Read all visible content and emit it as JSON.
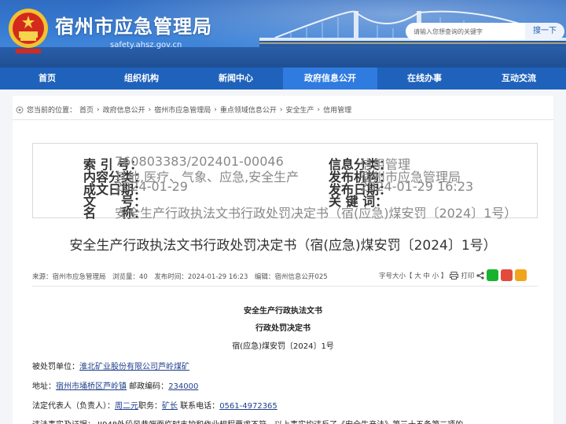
{
  "header": {
    "site_title": "宿州市应急管理局",
    "site_domain": "safety.ahsz.gov.cn",
    "search_placeholder": "请输入您想查询的关键字",
    "search_button": "搜一下"
  },
  "nav": {
    "items": [
      "首页",
      "组织机构",
      "新闻中心",
      "政府信息公开",
      "在线办事",
      "互动交流"
    ],
    "active_index": 3
  },
  "breadcrumb": {
    "prefix": "您当前的位置：",
    "items": [
      "首页",
      "政府信息公开",
      "宿州市应急管理局",
      "重点领域信息公开",
      "安全生产",
      "信用管理"
    ],
    "separator": "›"
  },
  "meta": {
    "index_label": "索 引 号：",
    "index_value": "760803383/202401-00046",
    "content_class_label": "内容分类：",
    "content_class_value": "其他,医疗、气象、应急,安全生产",
    "created_label": "成文日期：",
    "created_value": "2024-01-29",
    "docno_label": "文　　号：",
    "docno_value": "",
    "name_label": "名　　称：",
    "name_value": "安全生产行政执法文书行政处罚决定书（宿(应急)煤安罚〔2024〕1号）",
    "category_label": "信息分类：",
    "category_value": "信用管理",
    "publisher_label": "发布机构：",
    "publisher_value": "宿州市应急管理局",
    "pubdate_label": "发布日期：",
    "pubdate_value": "2024-01-29 16:23",
    "keywords_label": "关 键 词：",
    "keywords_value": ""
  },
  "doc": {
    "title": "安全生产行政执法文书行政处罚决定书（宿(应急)煤安罚〔2024〕1号）",
    "info_line": "来源：宿州市应急管理局　浏览量：40　发布时间：2024-01-29 16:23　编辑：宿州信息公开025",
    "font_size_label": "字号大小【 大  中  小 】",
    "print_label": "打印",
    "heading1": "安全生产行政执法文书",
    "heading2": "行政处罚决定书",
    "doc_number": "宿(应急)煤安罚〔2024〕1号",
    "party_label": "被处罚单位：",
    "party_value": "淮北矿业股份有限公司芦岭煤矿",
    "address_label": "地址：",
    "address_value": "宿州市埇桥区芦岭镇",
    "postcode_label": " 邮政编码：",
    "postcode_value": "234000",
    "rep_label": "法定代表人（负责人）：",
    "rep_value": "周二元",
    "position_label": "职务：",
    "position_value": "矿长",
    "phone_label": " 联系电话：",
    "phone_value": "0561-4972365",
    "facts_partial": "违法事实及证据：  II948外段风巷端面临时支护和作业规程要求不符，以上事实均违反了《安全生产法》第三十五条第二项的"
  },
  "colors": {
    "nav_bg": "#1f62bb",
    "nav_active": "#2f7be0",
    "link_underline": "#1f3f8c"
  }
}
